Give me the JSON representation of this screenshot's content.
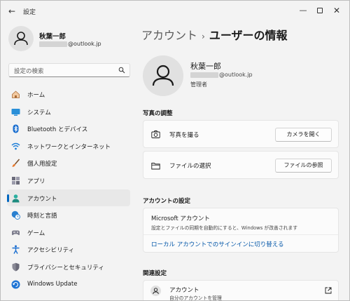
{
  "window": {
    "title": "設定",
    "controls": {
      "minimize": "—",
      "maximize": "□",
      "close": "✕"
    }
  },
  "profile": {
    "name": "秋葉一郎",
    "email_domain": "@outlook.jp"
  },
  "search": {
    "placeholder": "設定の検索"
  },
  "sidebar": {
    "items": [
      {
        "label": "ホーム",
        "icon": "home-icon"
      },
      {
        "label": "システム",
        "icon": "monitor-icon"
      },
      {
        "label": "Bluetooth とデバイス",
        "icon": "bluetooth-icon"
      },
      {
        "label": "ネットワークとインターネット",
        "icon": "wifi-icon"
      },
      {
        "label": "個人用設定",
        "icon": "brush-icon"
      },
      {
        "label": "アプリ",
        "icon": "apps-icon"
      },
      {
        "label": "アカウント",
        "icon": "person-icon",
        "active": true
      },
      {
        "label": "時刻と言語",
        "icon": "globe-clock-icon"
      },
      {
        "label": "ゲーム",
        "icon": "gamepad-icon"
      },
      {
        "label": "アクセシビリティ",
        "icon": "accessibility-icon"
      },
      {
        "label": "プライバシーとセキュリティ",
        "icon": "shield-icon"
      },
      {
        "label": "Windows Update",
        "icon": "update-icon"
      }
    ]
  },
  "breadcrumb": {
    "parent": "アカウント",
    "separator": "›",
    "current": "ユーザーの情報"
  },
  "user": {
    "name": "秋葉一郎",
    "email_domain": "@outlook.jp",
    "role": "管理者"
  },
  "photo_section": {
    "title": "写真の調整",
    "camera": {
      "label": "写真を撮る",
      "button": "カメラを開く"
    },
    "file": {
      "label": "ファイルの選択",
      "button": "ファイルの参照"
    }
  },
  "account_settings": {
    "title": "アカウントの設定",
    "ms_title": "Microsoft アカウント",
    "ms_desc": "設定とファイルの同期を自動的にすると、Windows が改善されます",
    "link": "ローカル アカウントでのサインインに切り替える"
  },
  "related": {
    "title": "関連設定",
    "item_title": "アカウント",
    "item_sub": "自分のアカウントを管理"
  },
  "colors": {
    "accent": "#0067c0",
    "link": "#0055a8",
    "background": "#f3f3f3",
    "card": "#fbfbfb"
  }
}
